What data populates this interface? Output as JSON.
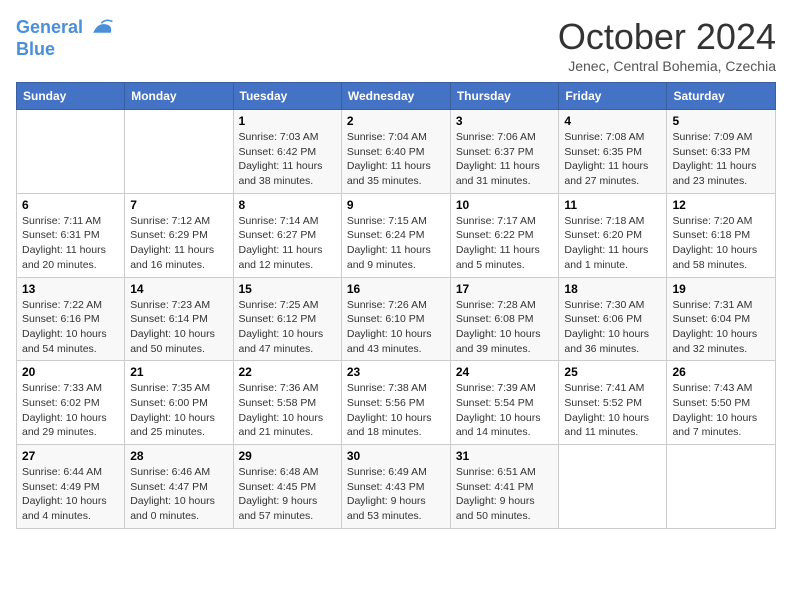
{
  "header": {
    "logo_line1": "General",
    "logo_line2": "Blue",
    "month": "October 2024",
    "location": "Jenec, Central Bohemia, Czechia"
  },
  "days_of_week": [
    "Sunday",
    "Monday",
    "Tuesday",
    "Wednesday",
    "Thursday",
    "Friday",
    "Saturday"
  ],
  "weeks": [
    [
      {
        "day": "",
        "info": ""
      },
      {
        "day": "",
        "info": ""
      },
      {
        "day": "1",
        "info": "Sunrise: 7:03 AM\nSunset: 6:42 PM\nDaylight: 11 hours and 38 minutes."
      },
      {
        "day": "2",
        "info": "Sunrise: 7:04 AM\nSunset: 6:40 PM\nDaylight: 11 hours and 35 minutes."
      },
      {
        "day": "3",
        "info": "Sunrise: 7:06 AM\nSunset: 6:37 PM\nDaylight: 11 hours and 31 minutes."
      },
      {
        "day": "4",
        "info": "Sunrise: 7:08 AM\nSunset: 6:35 PM\nDaylight: 11 hours and 27 minutes."
      },
      {
        "day": "5",
        "info": "Sunrise: 7:09 AM\nSunset: 6:33 PM\nDaylight: 11 hours and 23 minutes."
      }
    ],
    [
      {
        "day": "6",
        "info": "Sunrise: 7:11 AM\nSunset: 6:31 PM\nDaylight: 11 hours and 20 minutes."
      },
      {
        "day": "7",
        "info": "Sunrise: 7:12 AM\nSunset: 6:29 PM\nDaylight: 11 hours and 16 minutes."
      },
      {
        "day": "8",
        "info": "Sunrise: 7:14 AM\nSunset: 6:27 PM\nDaylight: 11 hours and 12 minutes."
      },
      {
        "day": "9",
        "info": "Sunrise: 7:15 AM\nSunset: 6:24 PM\nDaylight: 11 hours and 9 minutes."
      },
      {
        "day": "10",
        "info": "Sunrise: 7:17 AM\nSunset: 6:22 PM\nDaylight: 11 hours and 5 minutes."
      },
      {
        "day": "11",
        "info": "Sunrise: 7:18 AM\nSunset: 6:20 PM\nDaylight: 11 hours and 1 minute."
      },
      {
        "day": "12",
        "info": "Sunrise: 7:20 AM\nSunset: 6:18 PM\nDaylight: 10 hours and 58 minutes."
      }
    ],
    [
      {
        "day": "13",
        "info": "Sunrise: 7:22 AM\nSunset: 6:16 PM\nDaylight: 10 hours and 54 minutes."
      },
      {
        "day": "14",
        "info": "Sunrise: 7:23 AM\nSunset: 6:14 PM\nDaylight: 10 hours and 50 minutes."
      },
      {
        "day": "15",
        "info": "Sunrise: 7:25 AM\nSunset: 6:12 PM\nDaylight: 10 hours and 47 minutes."
      },
      {
        "day": "16",
        "info": "Sunrise: 7:26 AM\nSunset: 6:10 PM\nDaylight: 10 hours and 43 minutes."
      },
      {
        "day": "17",
        "info": "Sunrise: 7:28 AM\nSunset: 6:08 PM\nDaylight: 10 hours and 39 minutes."
      },
      {
        "day": "18",
        "info": "Sunrise: 7:30 AM\nSunset: 6:06 PM\nDaylight: 10 hours and 36 minutes."
      },
      {
        "day": "19",
        "info": "Sunrise: 7:31 AM\nSunset: 6:04 PM\nDaylight: 10 hours and 32 minutes."
      }
    ],
    [
      {
        "day": "20",
        "info": "Sunrise: 7:33 AM\nSunset: 6:02 PM\nDaylight: 10 hours and 29 minutes."
      },
      {
        "day": "21",
        "info": "Sunrise: 7:35 AM\nSunset: 6:00 PM\nDaylight: 10 hours and 25 minutes."
      },
      {
        "day": "22",
        "info": "Sunrise: 7:36 AM\nSunset: 5:58 PM\nDaylight: 10 hours and 21 minutes."
      },
      {
        "day": "23",
        "info": "Sunrise: 7:38 AM\nSunset: 5:56 PM\nDaylight: 10 hours and 18 minutes."
      },
      {
        "day": "24",
        "info": "Sunrise: 7:39 AM\nSunset: 5:54 PM\nDaylight: 10 hours and 14 minutes."
      },
      {
        "day": "25",
        "info": "Sunrise: 7:41 AM\nSunset: 5:52 PM\nDaylight: 10 hours and 11 minutes."
      },
      {
        "day": "26",
        "info": "Sunrise: 7:43 AM\nSunset: 5:50 PM\nDaylight: 10 hours and 7 minutes."
      }
    ],
    [
      {
        "day": "27",
        "info": "Sunrise: 6:44 AM\nSunset: 4:49 PM\nDaylight: 10 hours and 4 minutes."
      },
      {
        "day": "28",
        "info": "Sunrise: 6:46 AM\nSunset: 4:47 PM\nDaylight: 10 hours and 0 minutes."
      },
      {
        "day": "29",
        "info": "Sunrise: 6:48 AM\nSunset: 4:45 PM\nDaylight: 9 hours and 57 minutes."
      },
      {
        "day": "30",
        "info": "Sunrise: 6:49 AM\nSunset: 4:43 PM\nDaylight: 9 hours and 53 minutes."
      },
      {
        "day": "31",
        "info": "Sunrise: 6:51 AM\nSunset: 4:41 PM\nDaylight: 9 hours and 50 minutes."
      },
      {
        "day": "",
        "info": ""
      },
      {
        "day": "",
        "info": ""
      }
    ]
  ]
}
